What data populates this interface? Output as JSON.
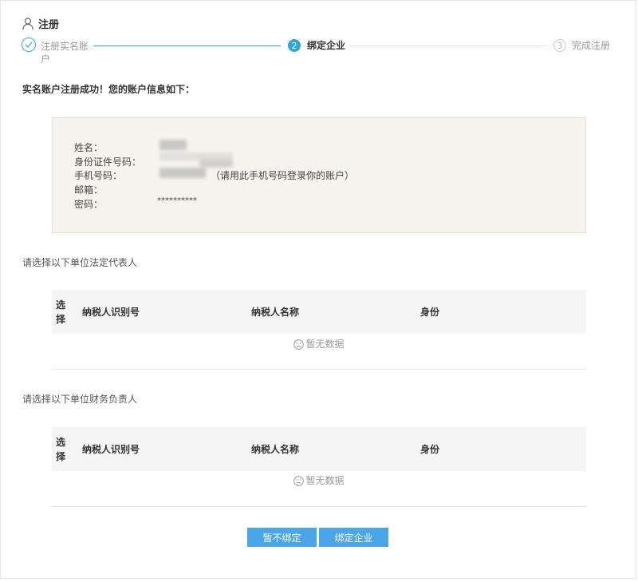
{
  "header": {
    "title": "注册"
  },
  "steps": [
    {
      "label": "注册实名账户",
      "status": "done"
    },
    {
      "number": "2",
      "label": "绑定企业",
      "status": "active"
    },
    {
      "number": "3",
      "label": "完成注册",
      "status": "pending"
    }
  ],
  "success_message": "实名账户注册成功！您的账户信息如下：",
  "account_info": {
    "name_label": "姓名：",
    "id_label": "身份证件号码：",
    "phone_label": "手机号码：",
    "phone_note": "（请用此手机号码登录你的账户）",
    "email_label": "邮箱：",
    "password_label": "密码：",
    "password_value": "**********"
  },
  "legal_section": {
    "title": "请选择以下单位法定代表人",
    "columns": [
      "选择",
      "纳税人识别号",
      "纳税人名称",
      "身份"
    ],
    "empty_text": "暂无数据"
  },
  "finance_section": {
    "title": "请选择以下单位财务负责人",
    "columns": [
      "选择",
      "纳税人识别号",
      "纳税人名称",
      "身份"
    ],
    "empty_text": "暂无数据"
  },
  "buttons": {
    "skip": "暂不绑定",
    "bind": "绑定企业"
  },
  "colors": {
    "accent": "#2ea7e0",
    "button": "#4aa6e8",
    "info_bg": "#f7f4ee"
  }
}
